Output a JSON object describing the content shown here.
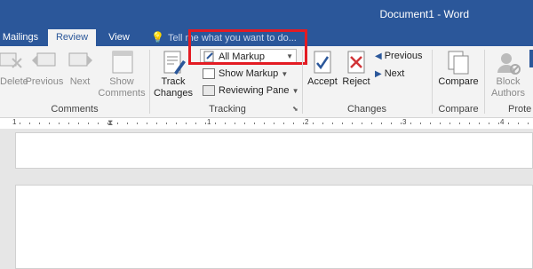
{
  "window": {
    "title": "Document1 - Word"
  },
  "tabs": [
    {
      "label": "Mailings"
    },
    {
      "label": "Review"
    },
    {
      "label": "View"
    }
  ],
  "tellme": {
    "text": "Tell me what you want to do..."
  },
  "comments": {
    "delete_label": "Delete",
    "previous_label": "Previous",
    "next_label": "Next",
    "show_label_1": "Show",
    "show_label_2": "Comments",
    "group_label": "Comments"
  },
  "tracking": {
    "track_label_1": "Track",
    "track_label_2": "Changes",
    "markup_select": "All Markup",
    "show_markup": "Show Markup",
    "reviewing_pane": "Reviewing Pane",
    "group_label": "Tracking"
  },
  "changes": {
    "accept_label": "Accept",
    "reject_label": "Reject",
    "previous_label": "Previous",
    "next_label": "Next",
    "group_label": "Changes"
  },
  "compare": {
    "compare_label": "Compare",
    "group_label": "Compare"
  },
  "protect": {
    "block_label_1": "Block",
    "block_label_2": "Authors",
    "group_label": "Prote"
  },
  "ruler": {
    "numbers": [
      "1",
      "1",
      "2",
      "3",
      "4"
    ]
  },
  "colors": {
    "title_bar": "#2b579a",
    "highlight": "#e31b23",
    "ribbon": "#f3f3f3"
  }
}
